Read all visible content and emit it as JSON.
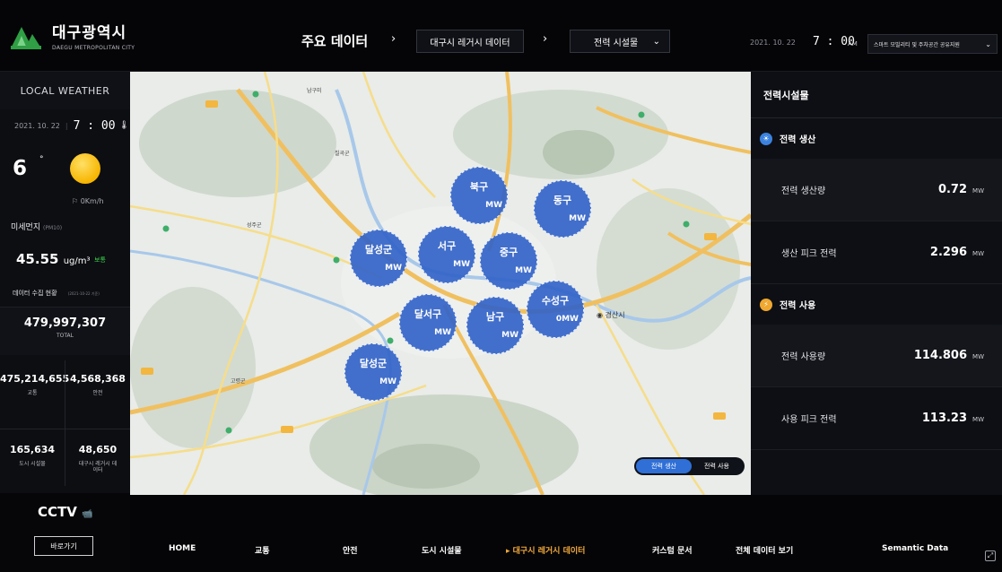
{
  "header": {
    "logo_title": "대구광역시",
    "logo_sub": "DAEGU METROPOLITAN CITY",
    "breadcrumb_main": "주요 데이터",
    "breadcrumb_arrow": "›",
    "breadcrumb_sub": "대구시 레거시 데이터",
    "facility_select": "전력 시설물",
    "date": "2021. 10. 22",
    "time": "7 : 00",
    "ampm": "AM",
    "service_select": "스마트 모빌리티 및 주차공간 공유지원"
  },
  "weather": {
    "title": "LOCAL  WEATHER",
    "date": "2021. 10. 22",
    "time": "7 : 00",
    "temperature": "6",
    "degree": "°",
    "wind": "0Km/h",
    "dust_label": "미세먼지",
    "dust_unit_label": "(PM10)",
    "dust_value": "45.55",
    "dust_unit": "ug/m³",
    "dust_status": "보통"
  },
  "collection": {
    "label": "데이터 수집 현황",
    "label_date": "(2021-10-22 기준)",
    "total_value": "479,997,307",
    "total_label": "TOTAL",
    "stats": [
      {
        "value": "475,214,655",
        "label": "교통"
      },
      {
        "value": "4,568,368",
        "label": "안전"
      },
      {
        "value": "165,634",
        "label": "도시 시설물"
      },
      {
        "value": "48,650",
        "label": "대구시 레거시 데이터"
      }
    ]
  },
  "cctv": {
    "title": "CCTV",
    "button": "바로가기"
  },
  "map": {
    "districts": [
      {
        "name": "북구",
        "unit": "MW"
      },
      {
        "name": "동구",
        "unit": "MW"
      },
      {
        "name": "달성군",
        "unit": "MW"
      },
      {
        "name": "서구",
        "unit": "MW"
      },
      {
        "name": "중구",
        "unit": "MW"
      },
      {
        "name": "수성구",
        "unit": "0MW"
      },
      {
        "name": "달서구",
        "unit": "MW"
      },
      {
        "name": "남구",
        "unit": "MW"
      },
      {
        "name": "달성군",
        "unit": "MW"
      }
    ],
    "toggle_on": "전력 생산",
    "toggle_off": "전력 사용",
    "place_labels": [
      "경산시",
      "칠곡군",
      "고령군",
      "성주군",
      "남구미",
      "대구"
    ]
  },
  "panel": {
    "title": "전력시설물",
    "production": {
      "section": "전력 생산",
      "rows": [
        {
          "label": "전력 생산량",
          "value": "0.72",
          "unit": "MW"
        },
        {
          "label": "생산 피크 전력",
          "value": "2.296",
          "unit": "MW"
        }
      ]
    },
    "usage": {
      "section": "전력 사용",
      "rows": [
        {
          "label": "전력 사용량",
          "value": "114.806",
          "unit": "MW"
        },
        {
          "label": "사용 피크 전력",
          "value": "113.23",
          "unit": "MW"
        }
      ]
    }
  },
  "nav": {
    "items": [
      "HOME",
      "교통",
      "안전",
      "도시 시설물",
      "▸  대구시 레거시 데이터",
      "커스텀 문서",
      "전체 데이터 보기",
      "Semantic Data"
    ]
  },
  "colors": {
    "accent_blue": "#2f6fd6",
    "bubble_blue": "#3364c8",
    "active_nav": "#f2a93b",
    "good_status": "#3ad44f",
    "sun": "#f7b500"
  }
}
